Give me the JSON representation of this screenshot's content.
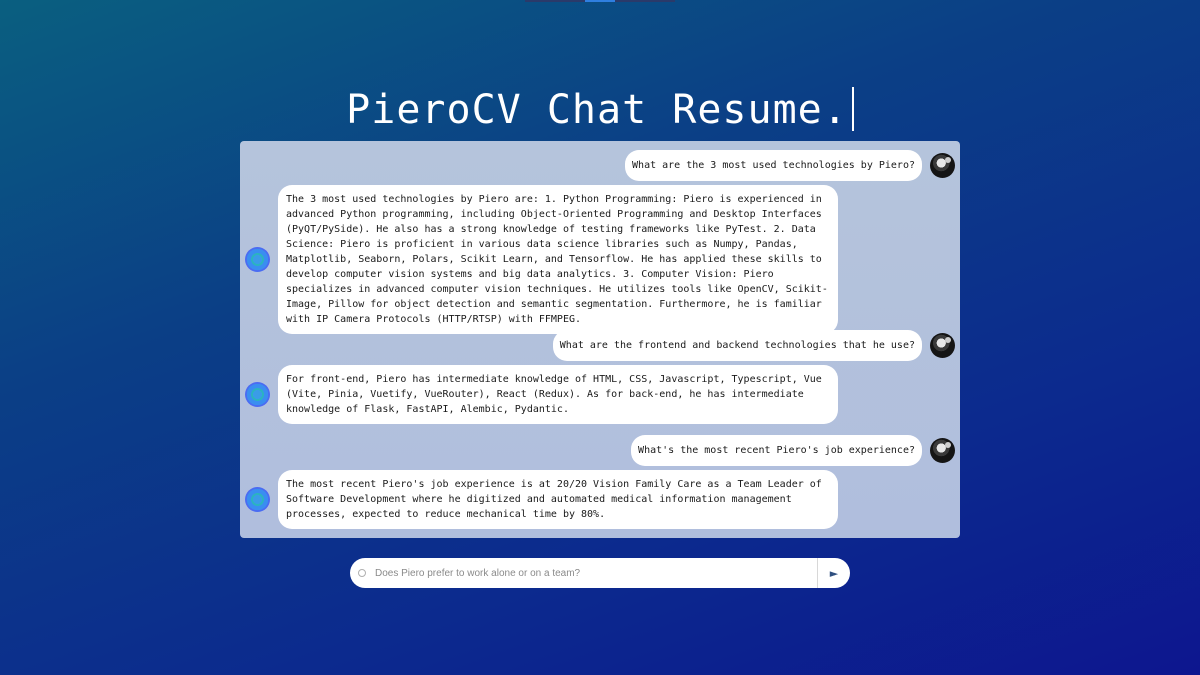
{
  "title": "PieroCV Chat Resume.",
  "chat": {
    "messages": [
      {
        "role": "user",
        "text": "What are the 3 most used technologies by Piero?"
      },
      {
        "role": "bot",
        "text": "The 3 most used technologies by Piero are: 1. Python Programming: Piero is experienced in advanced Python programming, including Object-Oriented Programming and Desktop Interfaces (PyQT/PySide). He also has a strong knowledge of testing frameworks like PyTest. 2. Data Science: Piero is proficient in various data science libraries such as Numpy, Pandas, Matplotlib, Seaborn, Polars, Scikit Learn, and Tensorflow. He has applied these skills to develop computer vision systems and big data analytics. 3. Computer Vision: Piero specializes in advanced computer vision techniques. He utilizes tools like OpenCV, Scikit-Image, Pillow for object detection and semantic segmentation. Furthermore, he is familiar with IP Camera Protocols (HTTP/RTSP) with FFMPEG."
      },
      {
        "role": "user",
        "text": "What are the frontend and backend technologies that he use?"
      },
      {
        "role": "bot",
        "text": "For front-end, Piero has intermediate knowledge of HTML, CSS, Javascript, Typescript, Vue (Vite, Pinia, Vuetify, VueRouter), React (Redux). As for back-end, he has intermediate knowledge of Flask, FastAPI, Alembic, Pydantic."
      },
      {
        "role": "user",
        "text": "What's the most recent Piero's job experience?"
      },
      {
        "role": "bot",
        "text": "The most recent Piero's job experience is at 20/20 Vision Family Care as a Team Leader of Software Development where he digitized and automated medical information management processes, expected to reduce mechanical time by 80%."
      }
    ]
  },
  "input": {
    "placeholder": "Does Piero prefer to work alone or on a team?",
    "send_icon": "send-icon"
  },
  "icons": {
    "user_avatar": "astronaut-avatar",
    "bot_avatar": "bot-avatar-icon"
  }
}
